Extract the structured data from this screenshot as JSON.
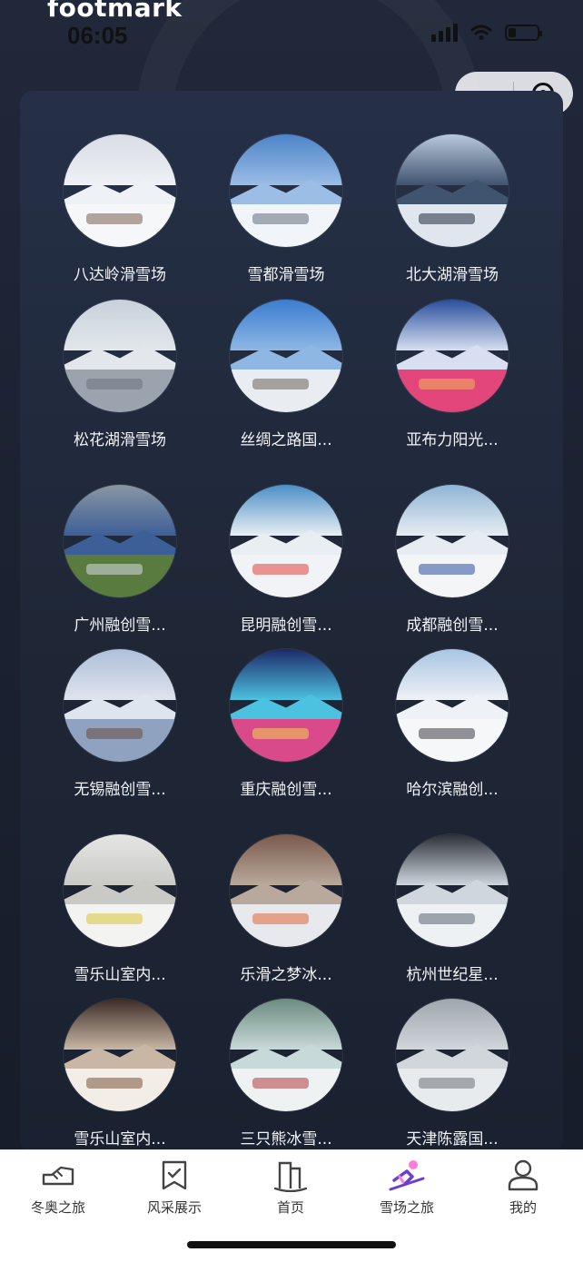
{
  "app": {
    "title": "footmark"
  },
  "status_bar": {
    "time": "06:05",
    "battery_level": 0.25
  },
  "resorts": [
    {
      "name": "八达岭滑雪场",
      "sky": "#d9dde4",
      "mid": "#eef1f5",
      "ground": "#f6f7f9",
      "accent": "#7a5f52"
    },
    {
      "name": "雪都滑雪场",
      "sky": "#4d83c8",
      "mid": "#9bbde6",
      "ground": "#f1f4f8",
      "accent": "#5f6e7d"
    },
    {
      "name": "北大湖滑雪场",
      "sky": "#b9c9dc",
      "mid": "#40536f",
      "ground": "#dfe6ee",
      "accent": "#1e2b3d"
    },
    {
      "name": "松花湖滑雪场",
      "sky": "#c7d1dc",
      "mid": "#e3e7ec",
      "ground": "#9aa3ae",
      "accent": "#6b7480"
    },
    {
      "name": "丝绸之路国...",
      "sky": "#3a7dd0",
      "mid": "#8fb7e4",
      "ground": "#e9edf2",
      "accent": "#6d6356"
    },
    {
      "name": "亚布力阳光...",
      "sky": "#2a4f9c",
      "mid": "#d7dff0",
      "ground": "#e3467a",
      "accent": "#f3b35a"
    },
    {
      "name": "广州融创雪...",
      "sky": "#8a96a2",
      "mid": "#3d5f98",
      "ground": "#5a7b3f",
      "accent": "#d6dbe3"
    },
    {
      "name": "昆明融创雪...",
      "sky": "#4a8fc7",
      "mid": "#e9eef3",
      "ground": "#f1f3f6",
      "accent": "#e0433f"
    },
    {
      "name": "成都融创雪...",
      "sky": "#8fb5d6",
      "mid": "#e6ecf2",
      "ground": "#f3f5f7",
      "accent": "#2d4fa0"
    },
    {
      "name": "无锡融创雪...",
      "sky": "#aebfd8",
      "mid": "#dfe5ee",
      "ground": "#8fa2c0",
      "accent": "#6b4d3e"
    },
    {
      "name": "重庆融创雪...",
      "sky": "#1d2a6a",
      "mid": "#4cc1e0",
      "ground": "#d84a8a",
      "accent": "#f2d34e"
    },
    {
      "name": "哈尔滨融创...",
      "sky": "#a8c5e3",
      "mid": "#eef2f6",
      "ground": "#f6f7f9",
      "accent": "#3c3c46"
    },
    {
      "name": "雪乐山室内...",
      "sky": "#e5e5e3",
      "mid": "#c9c9c6",
      "ground": "#f3f3f1",
      "accent": "#d8c23a"
    },
    {
      "name": "乐滑之梦冰...",
      "sky": "#7a5a4c",
      "mid": "#b9a99c",
      "ground": "#e7e9ec",
      "accent": "#e06a3c"
    },
    {
      "name": "杭州世纪星...",
      "sky": "#2b2f38",
      "mid": "#cfd6de",
      "ground": "#eef1f4",
      "accent": "#5d6572"
    },
    {
      "name": "雪乐山室内...",
      "sky": "#3b2b25",
      "mid": "#c8b7a5",
      "ground": "#f2ede6",
      "accent": "#7a5638"
    },
    {
      "name": "三只熊冰雪...",
      "sky": "#6d8b80",
      "mid": "#c8d9d9",
      "ground": "#eef2f3",
      "accent": "#b43c3c"
    },
    {
      "name": "天津陈露国...",
      "sky": "#9fa6ad",
      "mid": "#d1d6db",
      "ground": "#e8ebee",
      "accent": "#6b7279"
    }
  ],
  "tabbar": {
    "items": [
      {
        "label": "冬奥之旅",
        "icon": "shoe-icon",
        "active": false
      },
      {
        "label": "风采展示",
        "icon": "bookmark-icon",
        "active": false
      },
      {
        "label": "首页",
        "icon": "home-icon",
        "active": false
      },
      {
        "label": "雪场之旅",
        "icon": "skier-icon",
        "active": true
      },
      {
        "label": "我的",
        "icon": "person-icon",
        "active": false
      }
    ],
    "active_color": "#6a3fd6",
    "active_glow": "#ff7ad9"
  }
}
